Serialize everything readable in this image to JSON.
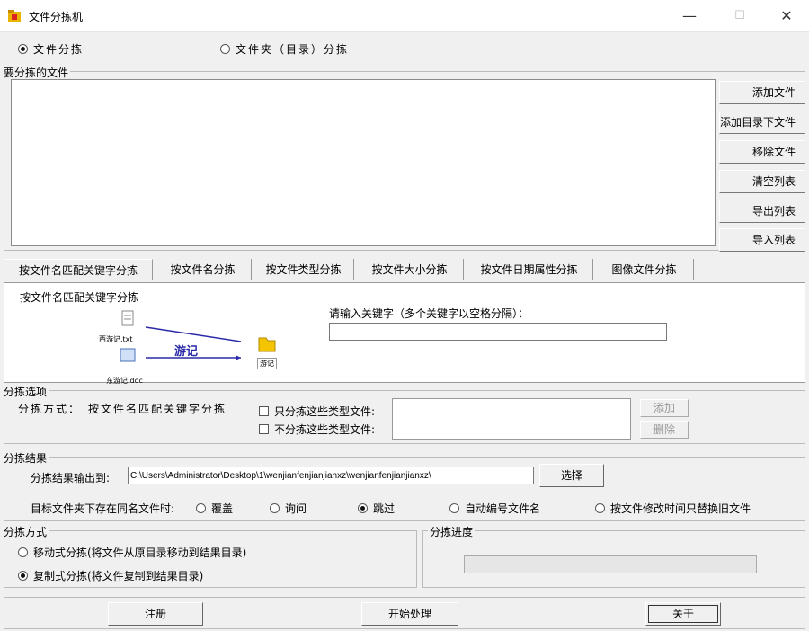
{
  "window": {
    "title": "文件分拣机",
    "minimize": "—",
    "maximize": "☐",
    "close": "✕"
  },
  "mode": {
    "file_mode": "文件分拣",
    "folder_mode": "文件夹（目录）分拣",
    "selected": "file"
  },
  "files_group": {
    "label": "要分拣的文件",
    "buttons": [
      "添加文件",
      "添加目录下文件",
      "移除文件",
      "清空列表",
      "导出列表",
      "导入列表"
    ]
  },
  "tabs": [
    "按文件名匹配关键字分拣",
    "按文件名分拣",
    "按文件类型分拣",
    "按文件大小分拣",
    "按文件日期属性分拣",
    "图像文件分拣"
  ],
  "keyword_panel": {
    "title": "按文件名匹配关键字分拣",
    "diagram": {
      "file1": "西游记.txt",
      "file2": "东游记.doc",
      "keyword": "游记",
      "folder": "游记"
    },
    "prompt": "请输入关键字（多个关键字以空格分隔）：",
    "keyword_value": ""
  },
  "options": {
    "label": "分拣选项",
    "method_label": "分拣方式：",
    "method_value": "按文件名匹配关键字分拣",
    "only_types": "只分拣这些类型文件:",
    "not_types": "不分拣这些类型文件:",
    "add": "添加",
    "delete": "删除"
  },
  "result": {
    "label": "分拣结果",
    "output_label": "分拣结果输出到:",
    "output_path": "C:\\Users\\Administrator\\Desktop\\1\\wenjianfenjianjianxz\\wenjianfenjianjianxz\\",
    "browse": "选择",
    "conflict_label": "目标文件夹下存在同名文件时:",
    "conflict_options": [
      "覆盖",
      "询问",
      "跳过",
      "自动编号文件名",
      "按文件修改时间只替换旧文件"
    ],
    "conflict_selected": 2
  },
  "sort_method": {
    "label": "分拣方式",
    "move": "移动式分拣(将文件从原目录移动到结果目录)",
    "copy": "复制式分拣(将文件复制到结果目录)",
    "selected": "copy"
  },
  "progress": {
    "label": "分拣进度",
    "value": 0
  },
  "footer": {
    "register": "注册",
    "start": "开始处理",
    "about": "关于"
  }
}
